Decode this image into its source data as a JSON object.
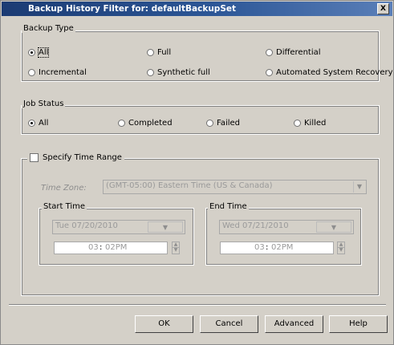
{
  "window": {
    "title": "Backup History Filter for: defaultBackupSet",
    "close_label": "X"
  },
  "backup_type": {
    "legend": "Backup Type",
    "options": [
      {
        "label": "All",
        "selected": true
      },
      {
        "label": "Full",
        "selected": false
      },
      {
        "label": "Differential",
        "selected": false
      },
      {
        "label": "Incremental",
        "selected": false
      },
      {
        "label": "Synthetic full",
        "selected": false
      },
      {
        "label": "Automated System Recovery",
        "selected": false
      }
    ]
  },
  "job_status": {
    "legend": "Job Status",
    "options": [
      {
        "label": "All",
        "selected": true
      },
      {
        "label": "Completed",
        "selected": false
      },
      {
        "label": "Failed",
        "selected": false
      },
      {
        "label": "Killed",
        "selected": false
      }
    ]
  },
  "time_range": {
    "checkbox_label": "Specify Time Range",
    "checked": false,
    "time_zone_label": "Time Zone:",
    "time_zone_value": "(GMT-05:00) Eastern Time (US & Canada)",
    "start": {
      "legend": "Start Time",
      "date": "Tue 07/20/2010",
      "hour": "03",
      "colon": ":",
      "minute": "02PM"
    },
    "end": {
      "legend": "End Time",
      "date": "Wed 07/21/2010",
      "hour": "03",
      "colon": ":",
      "minute": "02PM"
    }
  },
  "buttons": {
    "ok": "OK",
    "cancel": "Cancel",
    "advanced": "Advanced",
    "help": "Help"
  },
  "colors": {
    "title_bar_start": "#1b3b73",
    "title_bar_end": "#5a7fb8",
    "dialog_face": "#d4d0c8",
    "disabled_text": "#8e8e8e"
  },
  "icons": {
    "close": "close-icon",
    "dropdown": "chevron-down-icon",
    "spin_up": "spin-up-icon",
    "spin_down": "spin-down-icon"
  }
}
